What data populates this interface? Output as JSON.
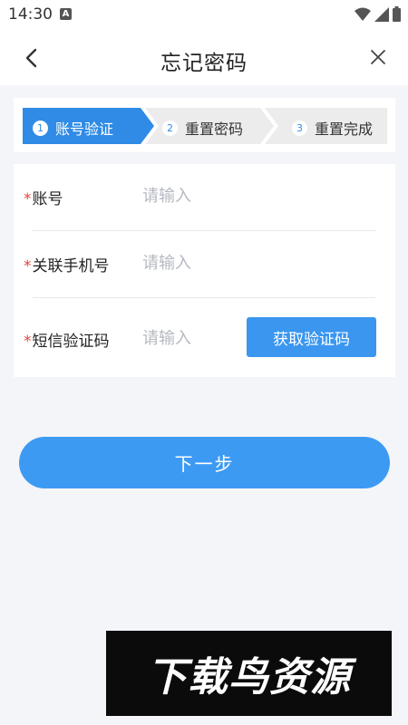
{
  "status_bar": {
    "time": "14:30",
    "a_badge": "A"
  },
  "nav": {
    "title": "忘记密码",
    "back_icon": "chevron-left-icon",
    "close_icon": "close-icon"
  },
  "steps": [
    {
      "number": "1",
      "label": "账号验证",
      "active": true
    },
    {
      "number": "2",
      "label": "重置密码",
      "active": false
    },
    {
      "number": "3",
      "label": "重置完成",
      "active": false
    }
  ],
  "form": {
    "required_mark": "*",
    "account": {
      "label": "账号",
      "placeholder": "请输入",
      "value": ""
    },
    "phone": {
      "label": "关联手机号",
      "placeholder": "请输入",
      "value": ""
    },
    "sms_code": {
      "label": "短信验证码",
      "placeholder": "请输入",
      "value": "",
      "button_label": "获取验证码"
    }
  },
  "next_button": {
    "label": "下一步"
  },
  "watermark": {
    "text": "下载鸟资源"
  },
  "colors": {
    "accent": "#3a96ef",
    "step_active": "#2f8be6",
    "step_inactive": "#ececec",
    "required": "#e64340",
    "page_bg": "#f3f5f8"
  }
}
